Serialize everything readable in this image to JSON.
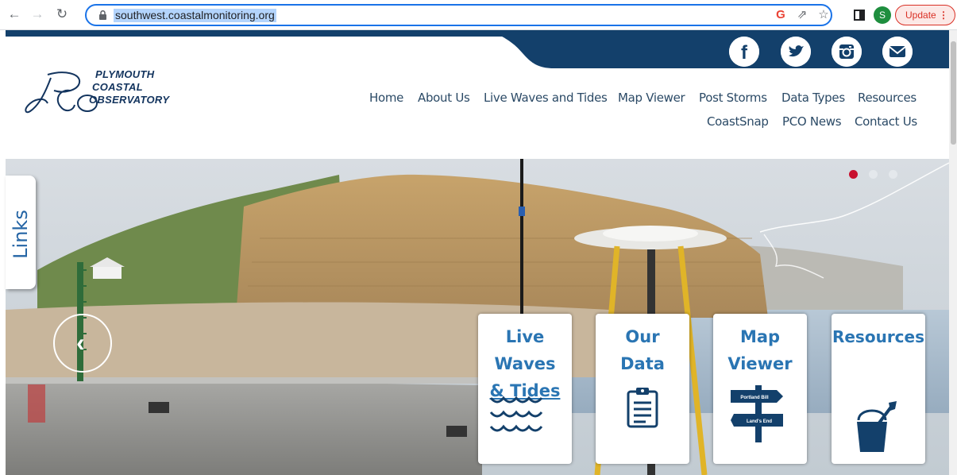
{
  "browser": {
    "url": "southwest.coastalmonitoring.org",
    "update_label": "Update",
    "profile_initial": "S",
    "icons": [
      "back-arrow-icon",
      "forward-arrow-icon",
      "reload-icon",
      "lock-icon",
      "google-icon",
      "share-icon",
      "star-icon",
      "side-panel-icon",
      "menu-dots-icon"
    ]
  },
  "logo": {
    "line1": "PLYMOUTH",
    "line2": "COASTAL",
    "line3": "OBSERVATORY",
    "monogram": "PCO"
  },
  "social": [
    "facebook-icon",
    "twitter-icon",
    "instagram-icon",
    "email-icon"
  ],
  "nav": {
    "row1": [
      "Home",
      "About Us",
      "Live Waves and Tides",
      "Map Viewer",
      "Post Storms",
      "Data Types",
      "Resources"
    ],
    "row2": [
      "CoastSnap",
      "PCO News",
      "Contact Us"
    ]
  },
  "links_tab": "Links",
  "cards": [
    {
      "title_lines": [
        "Live",
        "Waves",
        "& Tides"
      ],
      "icon": "waves-icon"
    },
    {
      "title_lines": [
        "Our",
        "Data"
      ],
      "icon": "clipboard-icon"
    },
    {
      "title_lines": [
        "Map",
        "Viewer"
      ],
      "icon": "signpost-icon",
      "sign_top": "Portland Bill",
      "sign_bottom": "Land's End"
    },
    {
      "title_lines": [
        "Resources"
      ],
      "icon": "bucket-spade-icon"
    }
  ],
  "colors": {
    "brand_navy": "#13406b",
    "card_text": "#2a75b3",
    "slider_active_dot": "#c8102e"
  }
}
